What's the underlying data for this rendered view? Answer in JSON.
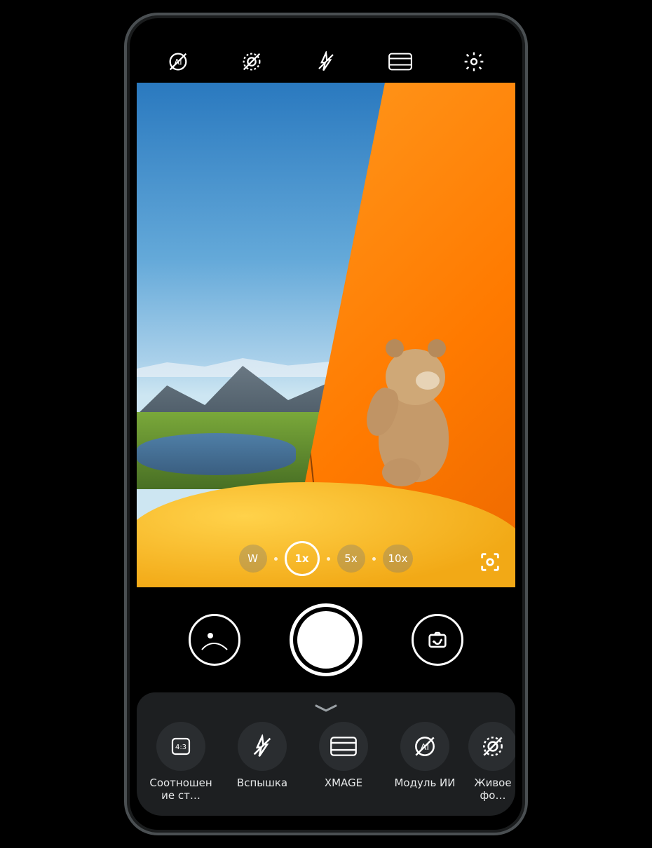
{
  "topbar": {
    "items": [
      {
        "name": "ai-off-icon"
      },
      {
        "name": "live-photo-off-icon"
      },
      {
        "name": "flash-off-icon"
      },
      {
        "name": "xmage-icon"
      },
      {
        "name": "settings-icon"
      }
    ]
  },
  "viewfinder": {
    "description": "teddy-bear-in-orange-tent-mountain-lake"
  },
  "zoom": {
    "options": [
      {
        "label": "W",
        "active": false
      },
      {
        "label": "1x",
        "active": true
      },
      {
        "label": "5x",
        "active": false
      },
      {
        "label": "10x",
        "active": false
      }
    ],
    "lens_button_name": "google-lens-icon"
  },
  "controls": {
    "gallery_button_name": "gallery-preview-button",
    "shutter_button_name": "shutter-button",
    "switch_camera_button_name": "switch-camera-button"
  },
  "sheet": {
    "items": [
      {
        "icon": "aspect-ratio-icon",
        "aspect_text": "4:3",
        "label": "Соотношение ст…"
      },
      {
        "icon": "flash-off-icon",
        "label": "Вспышка"
      },
      {
        "icon": "xmage-icon",
        "label": "XMAGE"
      },
      {
        "icon": "ai-off-icon",
        "label": "Модуль ИИ"
      },
      {
        "icon": "live-photo-off-icon",
        "label": "Живое фо…"
      }
    ]
  }
}
